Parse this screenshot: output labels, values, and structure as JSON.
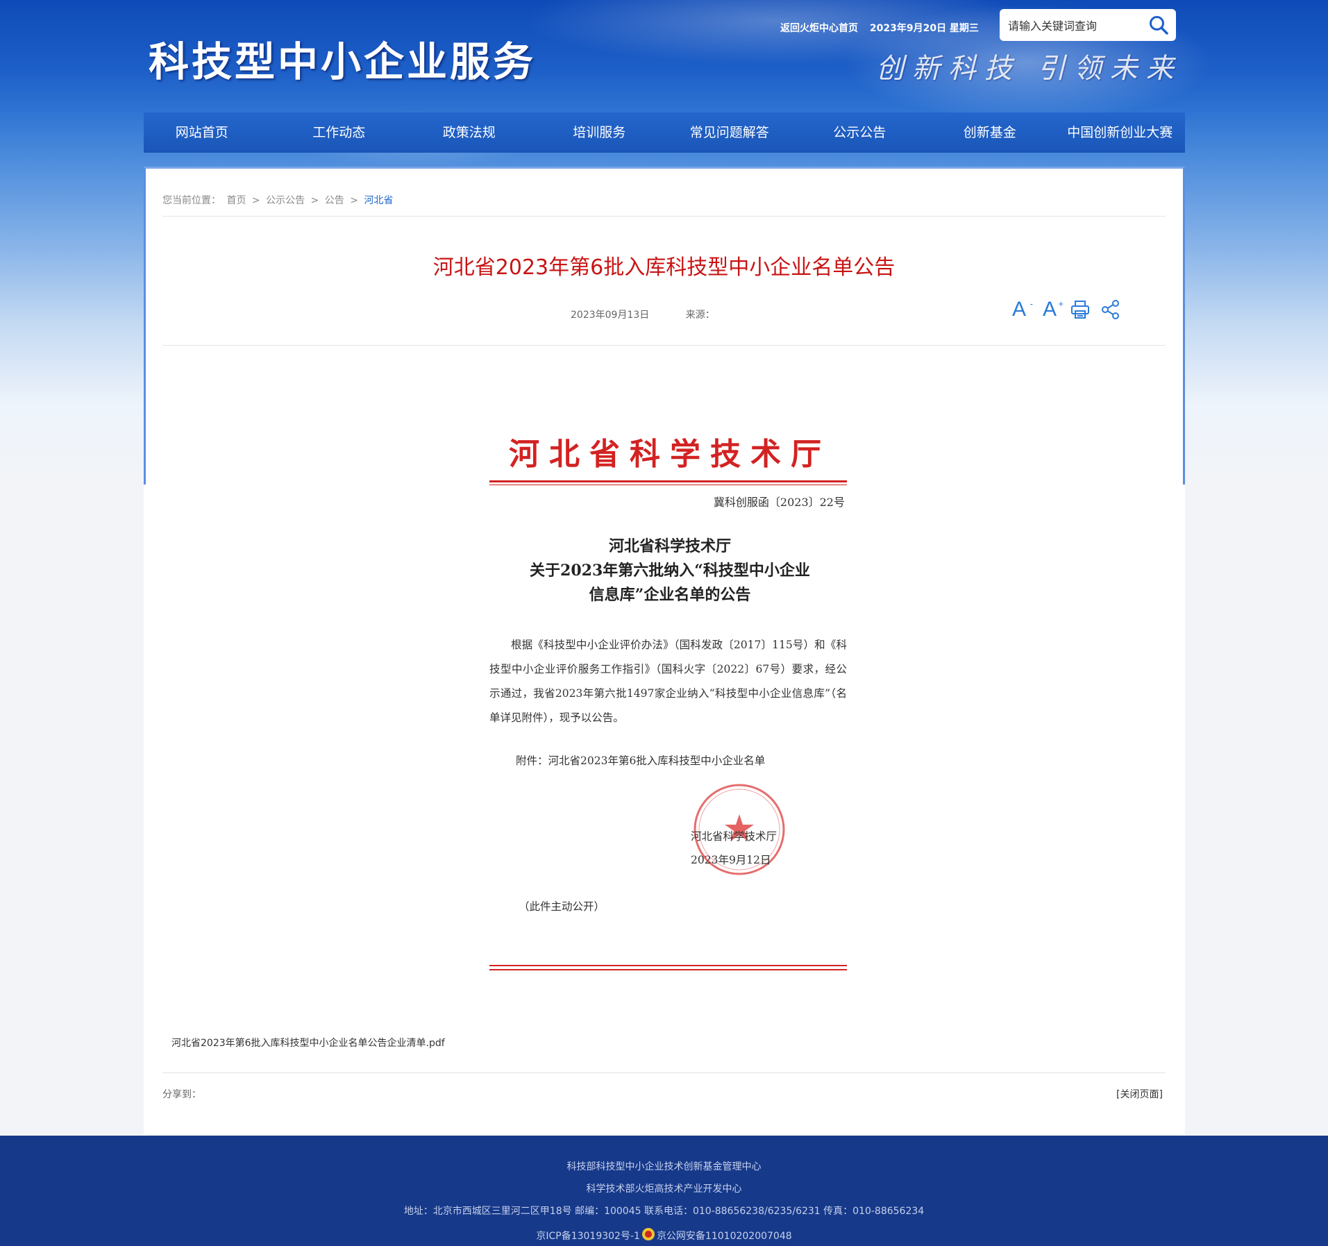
{
  "header": {
    "site_title": "科技型中小企业服务",
    "slogan": "创新科技  引领未来",
    "return_link": "返回火炬中心首页",
    "date": "2023年9月20日 星期三",
    "search_placeholder": "请输入关键词查询"
  },
  "nav": {
    "items": [
      "网站首页",
      "工作动态",
      "政策法规",
      "培训服务",
      "常见问题解答",
      "公示公告",
      "创新基金",
      "中国创新创业大赛"
    ]
  },
  "breadcrumb": {
    "label": "您当前位置：",
    "items": [
      "首页",
      "公示公告",
      "公告"
    ],
    "separator": ">",
    "current": "河北省"
  },
  "article": {
    "title": "河北省2023年第6批入库科技型中小企业名单公告",
    "date": "2023年09月13日",
    "source_label": "来源：",
    "tools": [
      "font-decrease-icon",
      "font-increase-icon",
      "print-icon",
      "share-icon"
    ]
  },
  "document": {
    "header": "河北省科学技术厅",
    "doc_number": "冀科创服函〔2023〕22号",
    "title_lines": [
      "河北省科学技术厅",
      "关于2023年第六批纳入“科技型中小企业",
      "信息库”企业名单的公告"
    ],
    "body": "根据《科技型中小企业评价办法》（国科发政〔2017〕115号）和《科技型中小企业评价服务工作指引》（国科火字〔2022〕67号）要求，经公示通过，我省2023年第六批1497家企业纳入“科技型中小企业信息库”（名单详见附件），现予以公告。",
    "attachment": "附件：河北省2023年第6批入库科技型中小企业名单",
    "signer": "河北省科学技术厅",
    "sign_date": "2023年9月12日",
    "publicity": "（此件主动公开）",
    "accent_color": "#d32222"
  },
  "attachment_file": "河北省2023年第6批入库科技型中小企业名单公告企业清单.pdf",
  "share_label": "分享到：",
  "close_label": "[关闭页面]",
  "footer": {
    "line1": "科技部科技型中小企业技术创新基金管理中心",
    "line2": "科学技术部火炬高技术产业开发中心",
    "line3": "地址：北京市西城区三里河二区甲18号 邮编：100045 联系电话：010-88656238/6235/6231 传真：010-88656234",
    "icp": "京ICP备13019302号-1",
    "police": "京公网安备11010202007048"
  },
  "colors": {
    "nav_bg": "#1a56b8",
    "title_red": "#c81414",
    "footer_bg": "#17398a",
    "link_blue": "#1f65c9"
  }
}
